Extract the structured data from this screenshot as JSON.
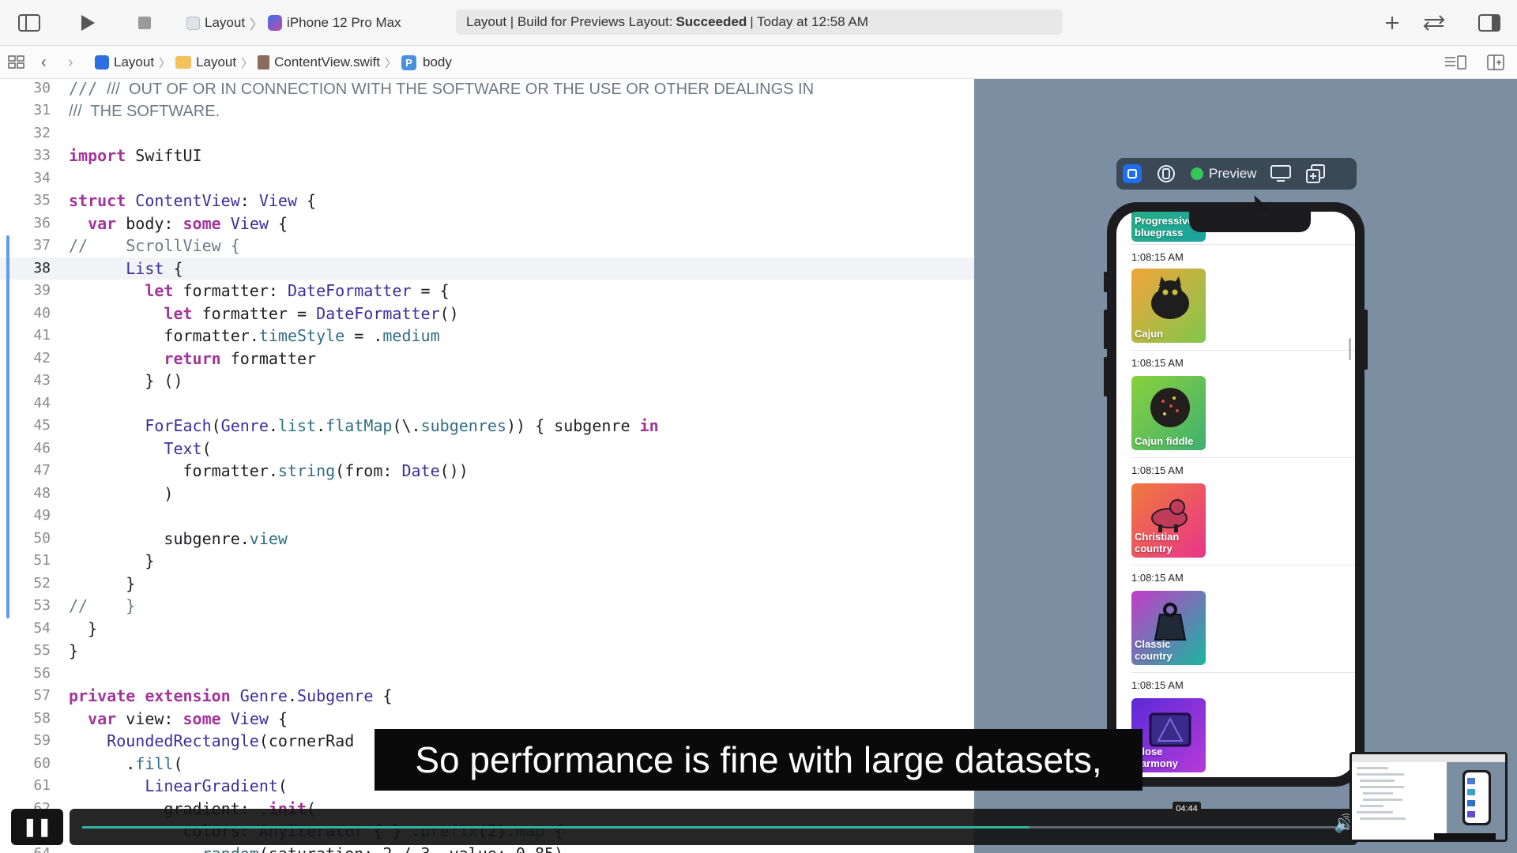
{
  "toolbar": {
    "project_name": "Layout",
    "device_name": "iPhone 12 Pro Max",
    "status_prefix": "Layout | Build for Previews Layout:",
    "status_result": "Succeeded",
    "status_suffix": "| Today at 12:58 AM"
  },
  "jumpbar": {
    "crumbs": [
      "Layout",
      "Layout",
      "ContentView.swift",
      "body"
    ],
    "symbol_letter": "P"
  },
  "editor": {
    "current_line": "38",
    "lines": [
      {
        "n": "30",
        "t": "///  OUT OF OR IN CONNECTION WITH THE SOFTWARE OR THE USE OR OTHER DEALINGS IN"
      },
      {
        "n": "31",
        "t": "///  THE SOFTWARE."
      },
      {
        "n": "32",
        "t": ""
      },
      {
        "n": "33",
        "t": "import SwiftUI"
      },
      {
        "n": "34",
        "t": ""
      },
      {
        "n": "35",
        "t": "struct ContentView: View {"
      },
      {
        "n": "36",
        "t": "  var body: some View {"
      },
      {
        "n": "37",
        "t": "//    ScrollView {"
      },
      {
        "n": "38",
        "t": "      List {"
      },
      {
        "n": "39",
        "t": "        let formatter: DateFormatter = {"
      },
      {
        "n": "40",
        "t": "          let formatter = DateFormatter()"
      },
      {
        "n": "41",
        "t": "          formatter.timeStyle = .medium"
      },
      {
        "n": "42",
        "t": "          return formatter"
      },
      {
        "n": "43",
        "t": "        } ()"
      },
      {
        "n": "44",
        "t": ""
      },
      {
        "n": "45",
        "t": "        ForEach(Genre.list.flatMap(\\.subgenres)) { subgenre in"
      },
      {
        "n": "46",
        "t": "          Text("
      },
      {
        "n": "47",
        "t": "            formatter.string(from: Date())"
      },
      {
        "n": "48",
        "t": "          )"
      },
      {
        "n": "49",
        "t": ""
      },
      {
        "n": "50",
        "t": "          subgenre.view"
      },
      {
        "n": "51",
        "t": "        }"
      },
      {
        "n": "52",
        "t": "      }"
      },
      {
        "n": "53",
        "t": "//    }"
      },
      {
        "n": "54",
        "t": "  }"
      },
      {
        "n": "55",
        "t": "}"
      },
      {
        "n": "56",
        "t": ""
      },
      {
        "n": "57",
        "t": "private extension Genre.Subgenre {"
      },
      {
        "n": "58",
        "t": "  var view: some View {"
      },
      {
        "n": "59",
        "t": "    RoundedRectangle(cornerRad"
      },
      {
        "n": "60",
        "t": "      .fill("
      },
      {
        "n": "61",
        "t": "        LinearGradient("
      },
      {
        "n": "62",
        "t": "          gradient: .init("
      },
      {
        "n": "63",
        "t": "            colors: AnyIterator { } .prefix(2).map {"
      },
      {
        "n": "64",
        "t": "              random(saturation: 2 / 3, value: 0.85)"
      }
    ]
  },
  "preview": {
    "label": "Preview",
    "partial_top_label": "Progressive\nbluegrass",
    "rows": [
      {
        "time": "1:08:15 AM",
        "label": "Cajun",
        "c1": "#f3a43a",
        "c2": "#7fc84c",
        "art": "cat"
      },
      {
        "time": "1:08:15 AM",
        "label": "Cajun fiddle",
        "c1": "#8ad13c",
        "c2": "#3fb070",
        "art": "ball"
      },
      {
        "time": "1:08:15 AM",
        "label": "Christian\ncountry",
        "c1": "#f07a3a",
        "c2": "#e8348a",
        "art": "pig"
      },
      {
        "time": "1:08:15 AM",
        "label": "Classic\ncountry",
        "c1": "#c33cc8",
        "c2": "#18b7a0",
        "art": "weight"
      },
      {
        "time": "1:08:15 AM",
        "label": "Close\nharmony",
        "c1": "#5b2ad8",
        "c2": "#b63ad8",
        "art": "sign"
      }
    ],
    "first_time": "1:08:15 AM"
  },
  "player": {
    "caption": "So performance is fine with large datasets,",
    "time": "04:44",
    "progress": 0.75
  }
}
